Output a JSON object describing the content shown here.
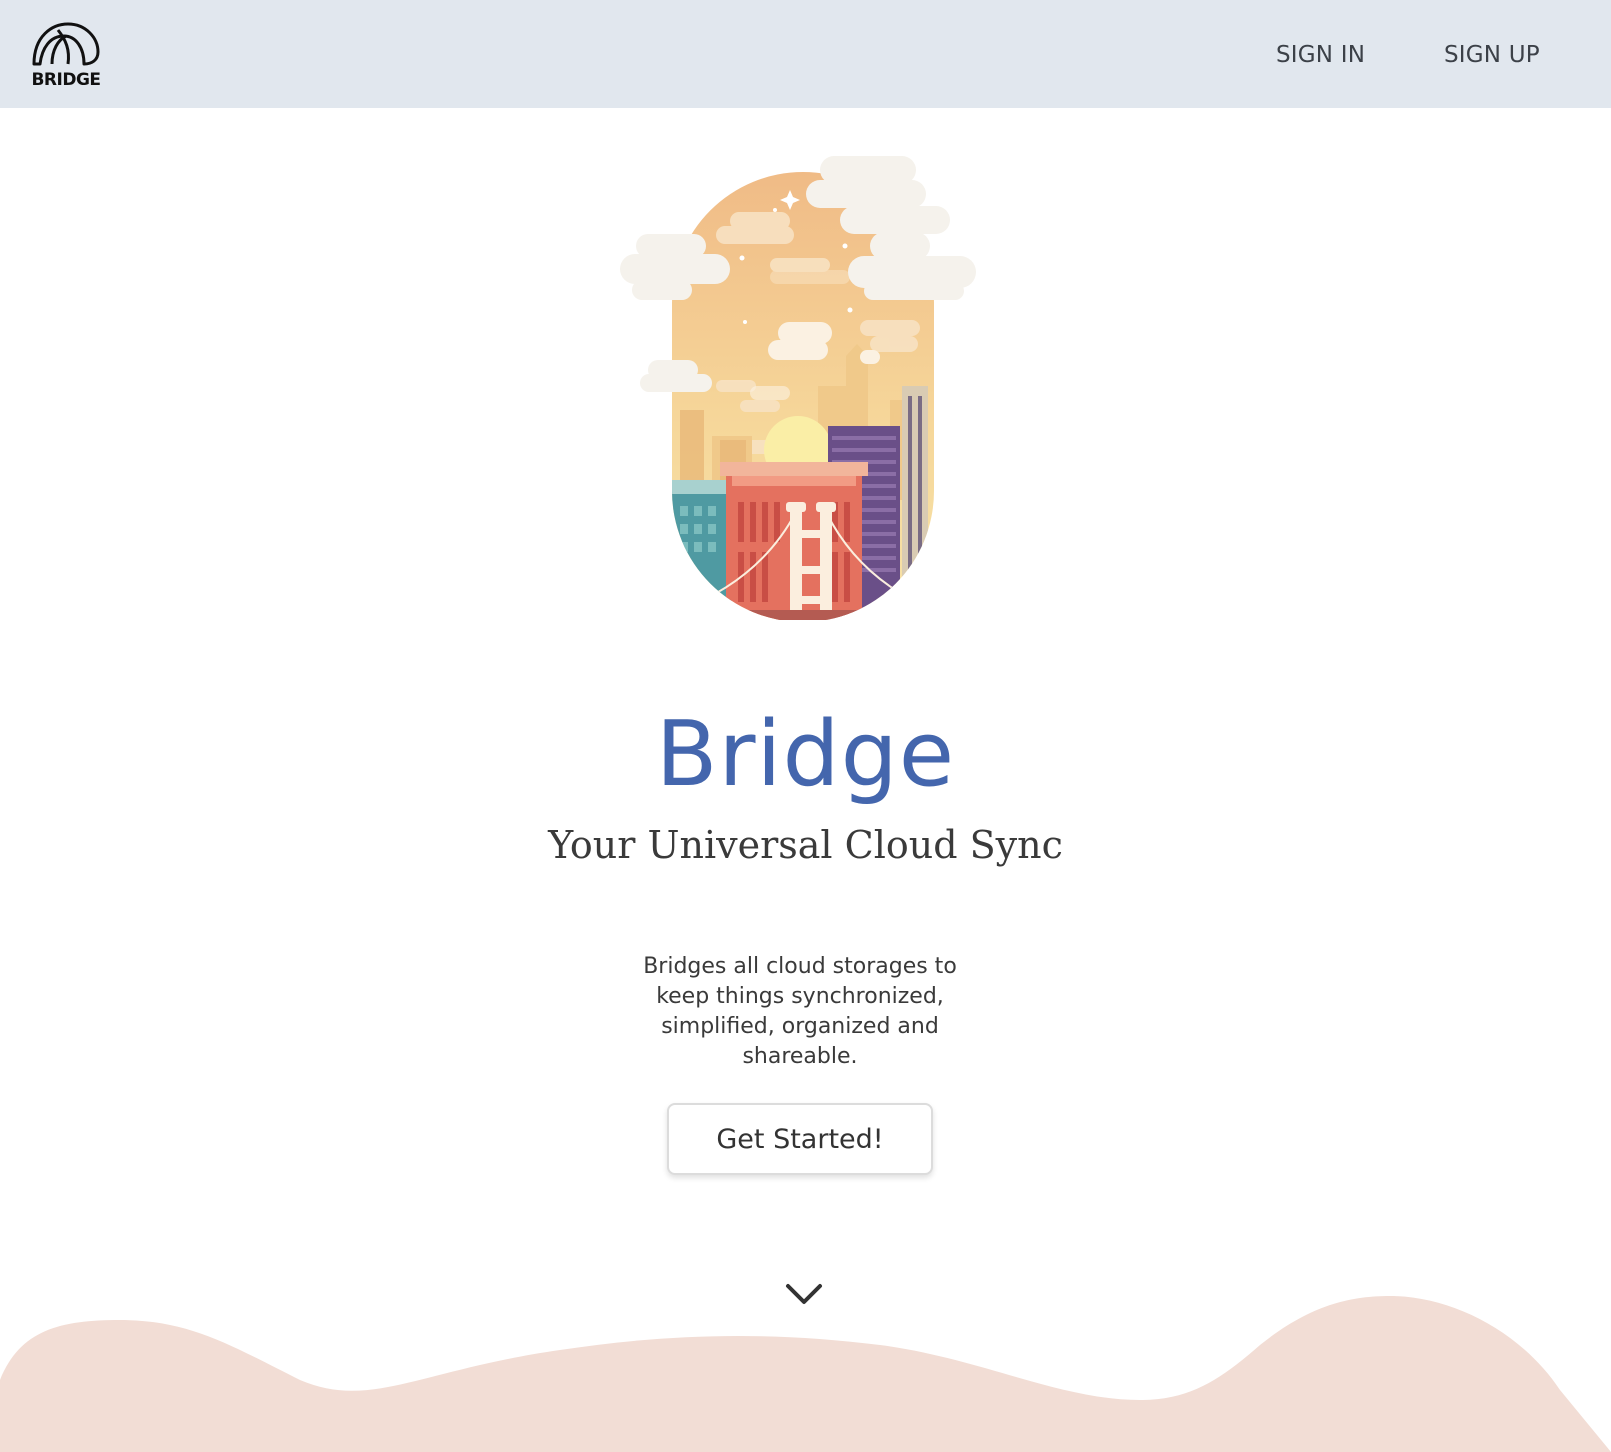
{
  "header": {
    "logo_text": "BRIDGE",
    "nav": {
      "sign_in": "SIGN IN",
      "sign_up": "SIGN UP"
    }
  },
  "hero": {
    "title": "Bridge",
    "subtitle": "Your Universal Cloud Sync",
    "description": "Bridges all cloud storages to keep things synchronized, simplified, organized and shareable.",
    "cta_label": "Get Started!"
  },
  "icons": {
    "logo": "bridge-arch-icon",
    "scroll": "chevron-down-icon"
  },
  "colors": {
    "header_bg": "#e1e7ee",
    "title": "#4466ad",
    "text": "#3a3a3a",
    "wave": "#f2ddd5"
  }
}
